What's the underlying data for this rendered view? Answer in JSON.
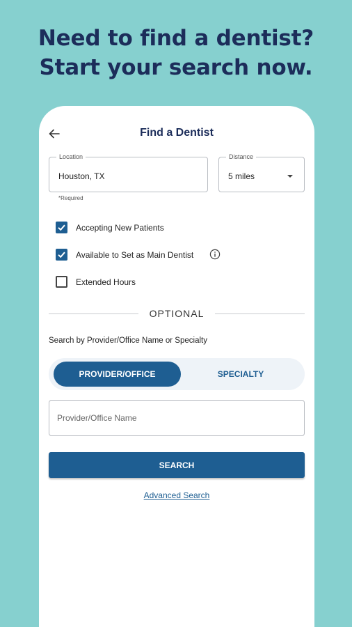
{
  "headline": {
    "line1": "Need to find a dentist?",
    "line2": "Start your search now."
  },
  "colors": {
    "background": "#86d0cf",
    "headline": "#1c2d5a",
    "primary": "#1e5e92",
    "toggle_track": "#eef3f8"
  },
  "topbar": {
    "back_icon": "arrow-left-icon",
    "title": "Find a Dentist"
  },
  "location": {
    "label": "Location",
    "value": "Houston, TX",
    "note": "*Required"
  },
  "distance": {
    "label": "Distance",
    "value": "5 miles"
  },
  "filters": [
    {
      "label": "Accepting New Patients",
      "checked": true
    },
    {
      "label": "Available to Set as Main Dentist",
      "checked": true,
      "icon": "info-icon"
    },
    {
      "label": "Extended Hours",
      "checked": false
    }
  ],
  "optional_label": "OPTIONAL",
  "search_by_label": "Search by Provider/Office Name or Specialty",
  "toggle": {
    "active": "PROVIDER/OFFICE",
    "inactive": "SPECIALTY"
  },
  "name_input": {
    "placeholder": "Provider/Office Name"
  },
  "search_button": "SEARCH",
  "advanced_link": "Advanced Search"
}
